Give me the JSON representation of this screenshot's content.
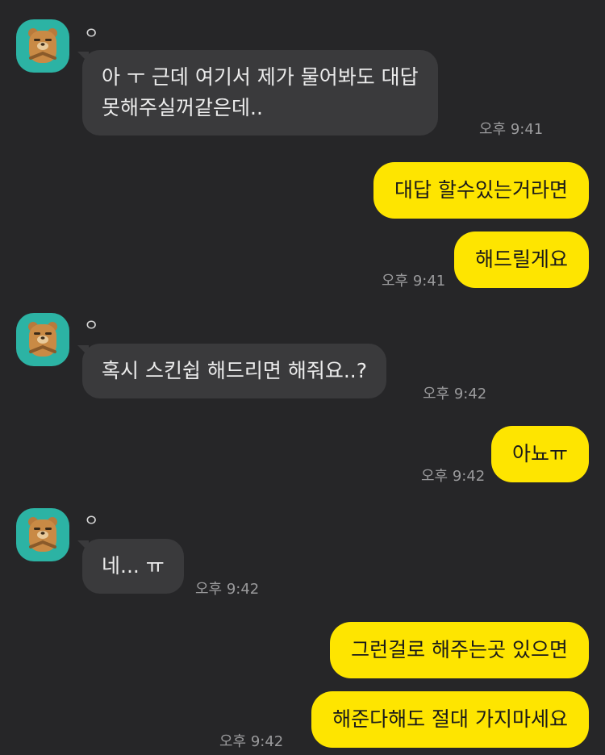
{
  "chat": {
    "groups": [
      {
        "sender": "ㅇ",
        "messages": [
          "아 ㅜ 근데 여기서 제가 물어봐도 대답",
          "못해주실꺼같은데.."
        ],
        "time": "오후 9:41"
      },
      {
        "me": true,
        "messages": [
          "대답 할수있는거라면",
          "해드릴게요"
        ],
        "time": "오후 9:41"
      },
      {
        "sender": "ㅇ",
        "messages": [
          "혹시 스킨쉽 해드리면 해줘요..?"
        ],
        "time": "오후 9:42"
      },
      {
        "me": true,
        "messages": [
          "아뇨ㅠ"
        ],
        "time": "오후 9:42"
      },
      {
        "sender": "ㅇ",
        "messages": [
          "네... ㅠ"
        ],
        "time": "오후 9:42"
      },
      {
        "me": true,
        "messages": [
          "그런걸로 해주는곳 있으면",
          "해준다해도 절대 가지마세요"
        ],
        "time": "오후 9:42"
      }
    ]
  },
  "colors": {
    "background": "#262628",
    "incoming_bubble": "#3a3a3c",
    "outgoing_bubble": "#fee500",
    "avatar_bg": "#2cb3a4"
  }
}
